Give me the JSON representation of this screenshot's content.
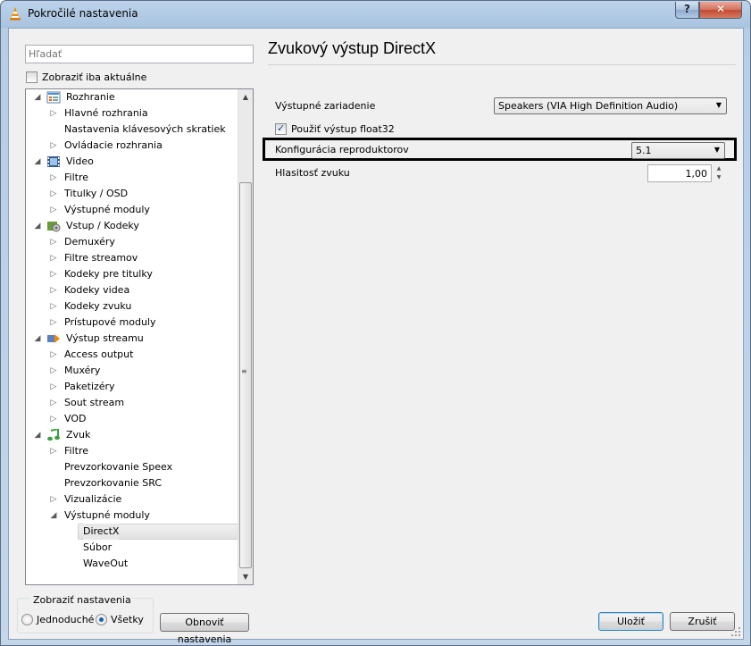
{
  "window": {
    "title": "Pokročilé nastavenia",
    "help_label": "?",
    "close_label": "✕"
  },
  "left": {
    "search_placeholder": "Hľadať",
    "show_current_only": "Zobraziť iba aktuálne",
    "tree": [
      {
        "label": "Rozhranie",
        "level": 0,
        "expanded": true,
        "icon": "interface-icon"
      },
      {
        "label": "Hlavné rozhrania",
        "level": 1,
        "has_children": true
      },
      {
        "label": "Nastavenia klávesových skratiek",
        "level": 1,
        "has_children": false
      },
      {
        "label": "Ovládacie rozhrania",
        "level": 1,
        "has_children": true
      },
      {
        "label": "Video",
        "level": 0,
        "expanded": true,
        "icon": "video-icon"
      },
      {
        "label": "Filtre",
        "level": 1,
        "has_children": true
      },
      {
        "label": "Titulky / OSD",
        "level": 1,
        "has_children": true
      },
      {
        "label": "Výstupné moduly",
        "level": 1,
        "has_children": true
      },
      {
        "label": "Vstup / Kodeky",
        "level": 0,
        "expanded": true,
        "icon": "input-codecs-icon"
      },
      {
        "label": "Demuxéry",
        "level": 1,
        "has_children": true
      },
      {
        "label": "Filtre streamov",
        "level": 1,
        "has_children": true
      },
      {
        "label": "Kodeky pre titulky",
        "level": 1,
        "has_children": true
      },
      {
        "label": "Kodeky videa",
        "level": 1,
        "has_children": true
      },
      {
        "label": "Kodeky zvuku",
        "level": 1,
        "has_children": true
      },
      {
        "label": "Prístupové moduly",
        "level": 1,
        "has_children": true
      },
      {
        "label": "Výstup streamu",
        "level": 0,
        "expanded": true,
        "icon": "stream-output-icon"
      },
      {
        "label": "Access output",
        "level": 1,
        "has_children": true
      },
      {
        "label": "Muxéry",
        "level": 1,
        "has_children": true
      },
      {
        "label": "Paketizéry",
        "level": 1,
        "has_children": true
      },
      {
        "label": "Sout stream",
        "level": 1,
        "has_children": true
      },
      {
        "label": "VOD",
        "level": 1,
        "has_children": true
      },
      {
        "label": "Zvuk",
        "level": 0,
        "expanded": true,
        "icon": "audio-icon"
      },
      {
        "label": "Filtre",
        "level": 1,
        "has_children": true
      },
      {
        "label": "Prevzorkovanie Speex",
        "level": 1,
        "has_children": false
      },
      {
        "label": "Prevzorkovanie SRC",
        "level": 1,
        "has_children": false
      },
      {
        "label": "Vizualizácie",
        "level": 1,
        "has_children": true
      },
      {
        "label": "Výstupné moduly",
        "level": 1,
        "has_children": true,
        "expanded": true
      },
      {
        "label": "DirectX",
        "level": 2,
        "has_children": false,
        "selected": true
      },
      {
        "label": "Súbor",
        "level": 2,
        "has_children": false
      },
      {
        "label": "WaveOut",
        "level": 2,
        "has_children": false
      }
    ],
    "show_settings": {
      "title": "Zobraziť nastavenia",
      "simple": "Jednoduché",
      "all": "Všetky",
      "selected": "all"
    },
    "reset_button": "Obnoviť nastavenia"
  },
  "right": {
    "title": "Zvukový výstup DirectX",
    "output_device_label": "Výstupné zariadenie",
    "output_device_value": "Speakers (VIA High Definition Audio)",
    "float32_label": "Použiť výstup float32",
    "float32_checked": true,
    "speaker_config_label": "Konfigurácia reproduktorov",
    "speaker_config_value": "5.1",
    "volume_label": "Hlasitosť zvuku",
    "volume_value": "1,00"
  },
  "buttons": {
    "save": "Uložiť",
    "cancel": "Zrušiť"
  },
  "colors": {
    "selection": "#e1e1e1",
    "highlight_border": "#000000",
    "default_button_border": "#3c7fb1"
  }
}
